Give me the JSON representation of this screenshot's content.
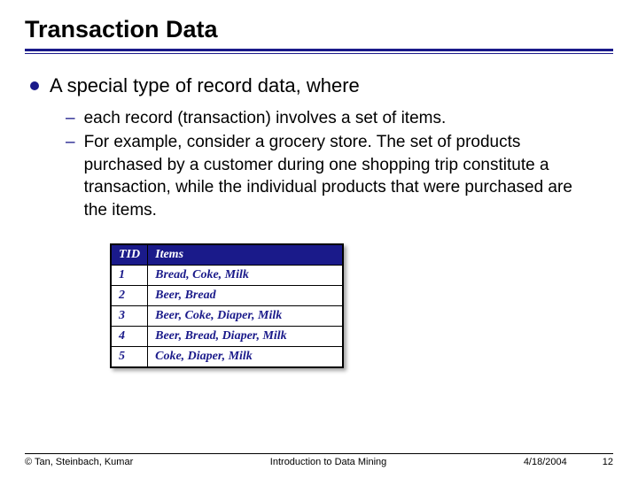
{
  "title": "Transaction Data",
  "bullet": "A special type of record data, where",
  "sub_items": [
    "each record (transaction) involves a set of items.",
    "For example, consider a grocery store.  The set of products purchased by a customer during one shopping trip constitute a transaction, while the individual products that were purchased are the items."
  ],
  "table": {
    "headers": {
      "tid": "TID",
      "items": "Items"
    },
    "rows": [
      {
        "tid": "1",
        "items": "Bread, Coke, Milk"
      },
      {
        "tid": "2",
        "items": "Beer, Bread"
      },
      {
        "tid": "3",
        "items": "Beer, Coke, Diaper, Milk"
      },
      {
        "tid": "4",
        "items": "Beer, Bread, Diaper, Milk"
      },
      {
        "tid": "5",
        "items": "Coke, Diaper, Milk"
      }
    ]
  },
  "footer": {
    "copyright": "© Tan, Steinbach, Kumar",
    "center": "Introduction to Data Mining",
    "date": "4/18/2004",
    "page": "12"
  }
}
